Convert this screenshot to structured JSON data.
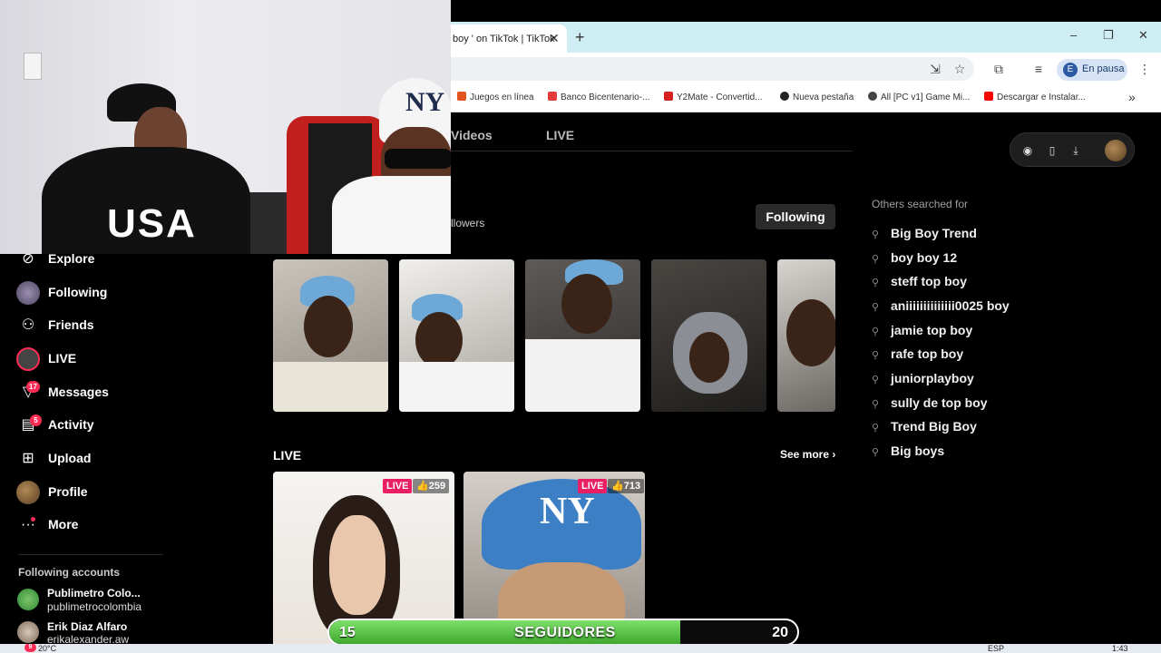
{
  "browser": {
    "tab_title": "boy ' on TikTok | TikTok",
    "tab_close": "✕",
    "new_tab": "+",
    "profile_initial": "E",
    "profile_status": "En pausa",
    "bookmarks": [
      {
        "label": "Juegos en línea",
        "color": "#e2541f"
      },
      {
        "label": "Banco Bicentenario-...",
        "color": "#e63b3b"
      },
      {
        "label": "Y2Mate - Convertid...",
        "color": "#d61f1f"
      },
      {
        "label": "Nueva pestaña",
        "color": "#222222"
      },
      {
        "label": "All [PC v1] Game Mi...",
        "color": "#444444"
      },
      {
        "label": "Descargar e Instalar...",
        "color": "#ff0000"
      }
    ],
    "bookmarks_overflow": "»"
  },
  "profile": {
    "tabs": [
      "Videos",
      "LIVE"
    ],
    "followers_text": "llowers",
    "following_button": "Following"
  },
  "sidebar": {
    "items": [
      {
        "label": "Explore",
        "icon": "compass-icon"
      },
      {
        "label": "Following",
        "icon": "following-avatar-icon"
      },
      {
        "label": "Friends",
        "icon": "friends-icon"
      },
      {
        "label": "LIVE",
        "icon": "live-icon"
      },
      {
        "label": "Messages",
        "icon": "messages-icon",
        "badge": "17"
      },
      {
        "label": "Activity",
        "icon": "activity-icon",
        "badge": "5"
      },
      {
        "label": "Upload",
        "icon": "upload-icon"
      },
      {
        "label": "Profile",
        "icon": "profile-avatar-icon"
      },
      {
        "label": "More",
        "icon": "more-icon"
      }
    ],
    "following_accounts_title": "Following accounts",
    "accounts": [
      {
        "name": "Publimetro Colo...",
        "handle": "publimetrocolombia"
      },
      {
        "name": "Erik Diaz Alfaro",
        "handle": "erikalexander.aw"
      }
    ]
  },
  "others_searched": {
    "title": "Others searched for",
    "items": [
      "Big Boy Trend",
      "boy boy 12",
      "steff top boy",
      "aniiiiiiiiiiiiii0025 boy",
      "jamie top boy",
      "rafe top boy",
      "juniorplayboy",
      "sully de top boy",
      "Trend Big Boy",
      "Big boys"
    ]
  },
  "live_section": {
    "title": "LIVE",
    "see_more": "See more ›",
    "cards": [
      {
        "badge": "LIVE",
        "likes": "259"
      },
      {
        "badge": "LIVE",
        "likes": "713"
      }
    ]
  },
  "goal_bar": {
    "start": "15",
    "label": "SEGUIDORES",
    "end": "20",
    "progress": 0.75,
    "fill_color": "#4cbc38"
  },
  "taskbar": {
    "weather": "20°C",
    "notification_count": "9",
    "lang": "ESP",
    "time": "1:43"
  }
}
